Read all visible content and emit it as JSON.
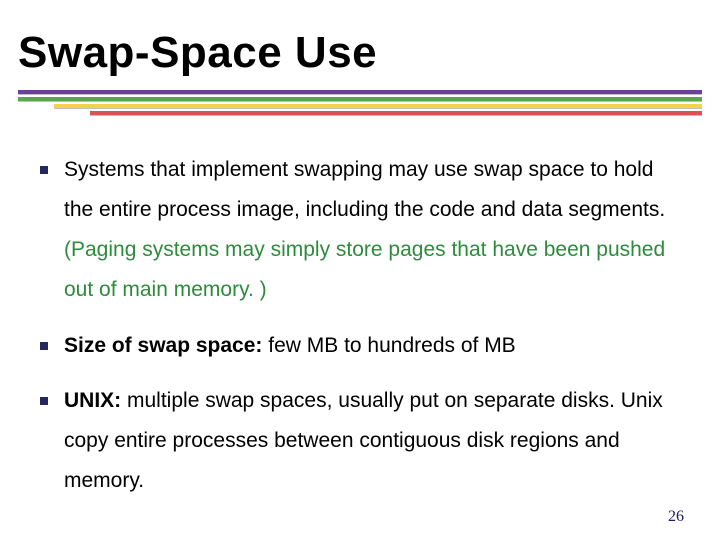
{
  "title": "Swap-Space Use",
  "bullets": {
    "b1": {
      "pre": "Systems that implement swapping may use swap space to hold the entire process image, including the code and data segments. ",
      "green": "(Paging systems may simply store pages that have been pushed out of main memory. )"
    },
    "b2": {
      "bold": "Size of swap space:",
      "rest": " few MB to hundreds of MB"
    },
    "b3": {
      "bold": "UNIX:",
      "rest": " multiple swap spaces, usually put on separate disks. Unix copy entire processes between contiguous disk regions and memory."
    }
  },
  "page_number": "26"
}
